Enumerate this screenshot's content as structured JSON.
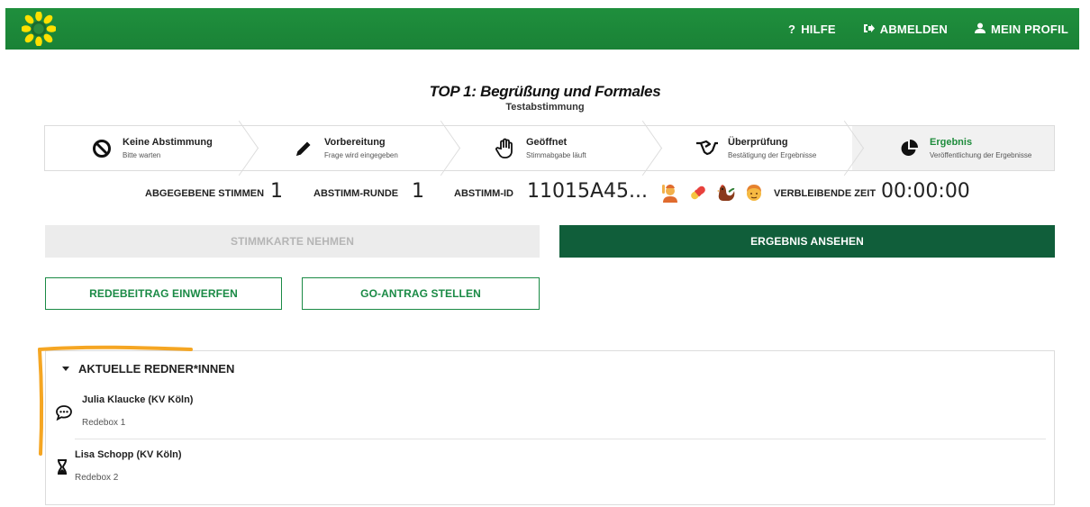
{
  "header": {
    "logo_icon": "sunflower-icon",
    "nav": [
      {
        "label": "HILFE",
        "icon": "question-icon"
      },
      {
        "label": "ABMELDEN",
        "icon": "logout-icon"
      },
      {
        "label": "MEIN PROFIL",
        "icon": "user-icon"
      }
    ]
  },
  "page": {
    "title": "TOP 1: Begrüßung und Formales",
    "subtitle": "Testabstimmung"
  },
  "steps": [
    {
      "name": "Keine Abstimmung",
      "desc": "Bitte warten",
      "icon": "ban-icon"
    },
    {
      "name": "Vorbereitung",
      "desc": "Frage wird eingegeben",
      "icon": "pencil-icon"
    },
    {
      "name": "Geöffnet",
      "desc": "Stimmabgabe läuft",
      "icon": "hand-icon"
    },
    {
      "name": "Überprüfung",
      "desc": "Bestätigung der Ergebnisse",
      "icon": "handshake-icon"
    },
    {
      "name": "Ergebnis",
      "desc": "Veröffentlichung der Ergebnisse",
      "icon": "pie-chart-icon",
      "active": true
    }
  ],
  "stats": {
    "votes_label": "ABGEGEBENE STIMMEN",
    "votes_value": "1",
    "round_label": "ABSTIMM-RUNDE",
    "round_value": "1",
    "id_label": "ABSTIMM-ID",
    "id_value": "11015A45...",
    "emojis": [
      "person-raising-hand-emoji",
      "pill-emoji",
      "rooster-emoji",
      "person-emoji"
    ],
    "time_label": "VERBLEIBENDE ZEIT",
    "time_value": "00:00:00"
  },
  "actions": {
    "take_ballot": "STIMMKARTE NEHMEN",
    "view_result": "ERGEBNIS ANSEHEN",
    "contribute": "REDEBEITRAG EINWERFEN",
    "go_motion": "GO-ANTRAG STELLEN"
  },
  "speakers": {
    "heading": "AKTUELLE REDNER*INNEN",
    "list": [
      {
        "name": "Julia Klaucke (KV Köln)",
        "box": "Redebox 1",
        "icon": "speech-bubble-icon"
      },
      {
        "name": "Lisa Schopp (KV Köln)",
        "box": "Redebox 2",
        "icon": "hourglass-icon"
      }
    ]
  },
  "colors": {
    "brand_green": "#1e8c3c",
    "dark_green": "#105e3a",
    "annotation": "#f5a623"
  }
}
